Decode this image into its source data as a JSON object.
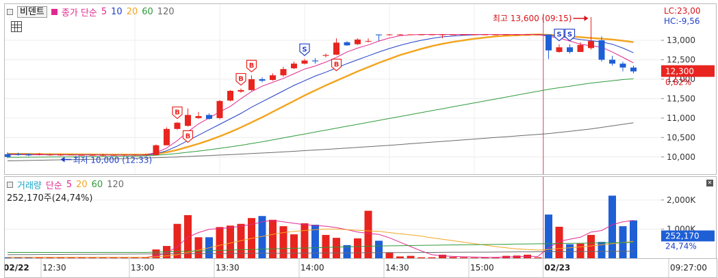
{
  "toolbar": {
    "compare_button": "비덴트"
  },
  "price_legend": {
    "label": "종가 단순",
    "periods": [
      "5",
      "10",
      "20",
      "60",
      "120"
    ],
    "colors": {
      "ma5": "#e0288f",
      "ma10": "#1f3fc8",
      "ma20": "#f2a520",
      "ma60": "#2e9a3a",
      "ma120": "#6a6a6a"
    }
  },
  "price_axis": {
    "ticks": [
      "13,000",
      "12,500",
      "12,000",
      "11,500",
      "11,000",
      "10,500",
      "10,000"
    ],
    "lc": "LC:23,00",
    "hc": "HC:-9,56",
    "current_price": "12,300",
    "current_change": "0,82%"
  },
  "annotations": {
    "high": "최고 13,600 (09:15)",
    "low": "최저 10,000 (12:33)",
    "markers": [
      "B",
      "B",
      "B",
      "S",
      "B",
      "B",
      "S",
      "S"
    ]
  },
  "volume_legend": {
    "label": "거래량",
    "ma_label": "단순",
    "periods": [
      "5",
      "20",
      "60",
      "120"
    ],
    "info": "252,170주(24,74%)"
  },
  "volume_axis": {
    "ticks": [
      "2,000K",
      "1,000K"
    ],
    "current_volume": "252,170",
    "current_pct": "24,74%"
  },
  "time_axis": {
    "labels": [
      "02/22",
      "12:30",
      "13:00",
      "13:30",
      "14:00",
      "14:30",
      "15:00",
      "02/23",
      "09:27:00"
    ]
  },
  "chart_data": [
    {
      "type": "candlestick",
      "title": "비덴트",
      "ylim": [
        9750,
        13650
      ],
      "x": [
        "02/22 12:26",
        "12:30",
        "12:34",
        "12:38",
        "12:42",
        "12:46",
        "12:50",
        "12:54",
        "12:58",
        "13:02",
        "13:06",
        "13:10",
        "13:14",
        "13:18",
        "13:22",
        "13:26",
        "13:30",
        "13:34",
        "13:38",
        "13:42",
        "13:46",
        "13:50",
        "13:54",
        "13:58",
        "14:02",
        "14:06",
        "14:10",
        "14:14",
        "14:18",
        "14:22",
        "14:26",
        "14:30",
        "14:34",
        "14:38",
        "14:42",
        "14:46",
        "14:50",
        "14:54",
        "14:58",
        "15:02",
        "15:06",
        "15:10",
        "15:14",
        "15:18",
        "15:22",
        "15:26",
        "15:30",
        "15:34",
        "15:38",
        "15:42",
        "15:46",
        "02/23 09:03",
        "09:06",
        "09:09",
        "09:12",
        "09:15",
        "09:18",
        "09:21",
        "09:24",
        "09:27"
      ],
      "open": [
        10070,
        10070,
        10060,
        10060,
        10050,
        10040,
        10040,
        10040,
        10040,
        10040,
        10040,
        10040,
        10040,
        10050,
        10050,
        10300,
        10720,
        10800,
        11000,
        11080,
        11000,
        11450,
        11680,
        11720,
        12000,
        11980,
        12100,
        12280,
        12400,
        12480,
        12600,
        12630,
        12950,
        12900,
        12980,
        13150,
        13150,
        13150,
        13150,
        13150,
        13150,
        13150,
        13150,
        13150,
        13150,
        13150,
        13150,
        13150,
        13150,
        13150,
        13150,
        13150,
        12700,
        12820,
        12700,
        12800,
        13000,
        12500,
        12400,
        12300
      ],
      "close": [
        10000,
        10050,
        10040,
        10080,
        10060,
        10060,
        10060,
        10050,
        10050,
        10050,
        10050,
        10060,
        10060,
        10060,
        10300,
        10720,
        10880,
        11080,
        11050,
        10980,
        11440,
        11700,
        11720,
        12000,
        11960,
        12100,
        12260,
        12400,
        12480,
        12460,
        12620,
        12940,
        12870,
        13020,
        12980,
        13130,
        13150,
        13150,
        13150,
        13150,
        13150,
        13150,
        13150,
        13150,
        13150,
        13150,
        13150,
        13150,
        13150,
        13150,
        13150,
        12740,
        12820,
        12700,
        12880,
        12980,
        12500,
        12400,
        12300,
        12200
      ],
      "high": [
        10120,
        10110,
        10090,
        10100,
        10080,
        10080,
        10070,
        10070,
        10070,
        10080,
        10060,
        10060,
        10060,
        10080,
        10320,
        10760,
        10900,
        11250,
        11160,
        11120,
        11460,
        11720,
        11760,
        12100,
        12050,
        12150,
        12320,
        12450,
        12520,
        12540,
        12660,
        13050,
        12980,
        13050,
        13050,
        13150,
        13160,
        13160,
        13160,
        13160,
        13160,
        13160,
        13160,
        13160,
        13160,
        13160,
        13160,
        13160,
        13160,
        13160,
        13160,
        13150,
        12900,
        12900,
        12950,
        13600,
        13100,
        12600,
        12450,
        12350
      ],
      "low": [
        9970,
        10030,
        10020,
        10040,
        10030,
        10030,
        10040,
        10030,
        10040,
        10020,
        10030,
        10030,
        10030,
        10040,
        10050,
        10300,
        10700,
        10780,
        10980,
        10960,
        10970,
        11430,
        11650,
        11700,
        11920,
        11960,
        12060,
        12260,
        12380,
        12400,
        12560,
        12620,
        12860,
        12880,
        12950,
        12980,
        13120,
        13140,
        13140,
        13140,
        13140,
        13050,
        13140,
        13140,
        13140,
        13140,
        13140,
        13140,
        13140,
        13140,
        13140,
        12520,
        12680,
        12660,
        12700,
        12760,
        12450,
        12350,
        12200,
        12150
      ],
      "ma5": [
        10060,
        10060,
        10055,
        10055,
        10055,
        10055,
        10050,
        10050,
        10050,
        10048,
        10048,
        10048,
        10048,
        10052,
        10110,
        10230,
        10420,
        10650,
        10850,
        11000,
        11160,
        11300,
        11500,
        11680,
        11820,
        11920,
        12020,
        12140,
        12260,
        12340,
        12440,
        12560,
        12700,
        12800,
        12880,
        12980,
        13060,
        13120,
        13140,
        13150,
        13150,
        13150,
        13150,
        13150,
        13150,
        13150,
        13150,
        13150,
        13150,
        13150,
        13150,
        13100,
        13060,
        12980,
        12900,
        12860,
        12820,
        12700,
        12560,
        12420
      ],
      "ma10": [
        10070,
        10068,
        10066,
        10062,
        10060,
        10058,
        10056,
        10054,
        10052,
        10050,
        10050,
        10050,
        10050,
        10050,
        10080,
        10160,
        10280,
        10420,
        10560,
        10700,
        10840,
        10980,
        11120,
        11280,
        11420,
        11560,
        11700,
        11840,
        11960,
        12080,
        12180,
        12290,
        12400,
        12500,
        12600,
        12700,
        12790,
        12870,
        12940,
        13000,
        13050,
        13090,
        13110,
        13130,
        13140,
        13150,
        13150,
        13150,
        13150,
        13150,
        13150,
        13130,
        13100,
        13060,
        13020,
        12990,
        12960,
        12900,
        12800,
        12680
      ],
      "ma20": [
        10080,
        10078,
        10076,
        10074,
        10072,
        10070,
        10068,
        10066,
        10064,
        10062,
        10060,
        10060,
        10060,
        10062,
        10080,
        10120,
        10180,
        10260,
        10340,
        10430,
        10530,
        10640,
        10760,
        10890,
        11020,
        11160,
        11300,
        11440,
        11580,
        11710,
        11840,
        11960,
        12080,
        12200,
        12310,
        12420,
        12520,
        12620,
        12700,
        12780,
        12850,
        12910,
        12960,
        13000,
        13040,
        13070,
        13100,
        13120,
        13130,
        13140,
        13150,
        13140,
        13120,
        13100,
        13080,
        13060,
        13040,
        13020,
        12990,
        12950
      ],
      "ma60": [
        9990,
        9992,
        9994,
        9996,
        9998,
        10000,
        10002,
        10004,
        10006,
        10008,
        10010,
        10015,
        10020,
        10030,
        10045,
        10065,
        10090,
        10120,
        10150,
        10185,
        10220,
        10260,
        10300,
        10345,
        10390,
        10440,
        10490,
        10540,
        10590,
        10640,
        10690,
        10740,
        10790,
        10840,
        10890,
        10940,
        10990,
        11040,
        11090,
        11140,
        11190,
        11240,
        11290,
        11340,
        11390,
        11440,
        11490,
        11540,
        11590,
        11640,
        11690,
        11740,
        11780,
        11820,
        11860,
        11900,
        11930,
        11960,
        11990,
        12010
      ],
      "ma120": [
        9900,
        9905,
        9910,
        9915,
        9920,
        9925,
        9930,
        9935,
        9940,
        9945,
        9950,
        9958,
        9966,
        9974,
        9982,
        9990,
        10000,
        10012,
        10024,
        10036,
        10048,
        10060,
        10074,
        10088,
        10102,
        10116,
        10130,
        10146,
        10162,
        10178,
        10194,
        10210,
        10228,
        10246,
        10264,
        10282,
        10300,
        10320,
        10340,
        10360,
        10380,
        10400,
        10420,
        10440,
        10460,
        10480,
        10500,
        10520,
        10540,
        10560,
        10580,
        10600,
        10630,
        10660,
        10690,
        10720,
        10760,
        10800,
        10840,
        10880
      ]
    },
    {
      "type": "bar",
      "title": "거래량",
      "ylim": [
        0,
        2700
      ],
      "series": [
        {
          "name": "거래량 (K)",
          "values": [
            30,
            30,
            30,
            30,
            30,
            30,
            30,
            30,
            30,
            30,
            30,
            30,
            30,
            30,
            300,
            420,
            1180,
            1480,
            720,
            720,
            1070,
            1120,
            1180,
            1380,
            1450,
            1320,
            1100,
            820,
            1200,
            1150,
            800,
            700,
            450,
            680,
            1630,
            600,
            200,
            60,
            80,
            30,
            30,
            120,
            40,
            30,
            20,
            20,
            20,
            80,
            90,
            120,
            30,
            1500,
            1080,
            480,
            500,
            800,
            560,
            2150,
            1100,
            1300,
            820,
            180
          ]
        },
        {
          "name": "5",
          "values": [
            30,
            30,
            30,
            30,
            30,
            30,
            30,
            30,
            30,
            30,
            30,
            30,
            30,
            30,
            80,
            180,
            400,
            720,
            880,
            990,
            1020,
            1050,
            1100,
            1160,
            1250,
            1300,
            1250,
            1200,
            1150,
            1120,
            1100,
            1050,
            980,
            900,
            850,
            820,
            700,
            550,
            400,
            250,
            120,
            80,
            60,
            50,
            40,
            30,
            30,
            40,
            50,
            60,
            60,
            360,
            580,
            650,
            720,
            900,
            950,
            1150,
            1250,
            1300,
            1260,
            1100
          ]
        },
        {
          "name": "20",
          "values": [
            30,
            30,
            30,
            30,
            30,
            30,
            30,
            30,
            30,
            30,
            30,
            30,
            30,
            30,
            50,
            80,
            120,
            200,
            280,
            360,
            440,
            520,
            600,
            680,
            750,
            820,
            880,
            920,
            950,
            980,
            1000,
            1000,
            980,
            960,
            940,
            920,
            880,
            840,
            800,
            760,
            700,
            650,
            600,
            550,
            500,
            450,
            400,
            360,
            320,
            300,
            280,
            300,
            330,
            360,
            390,
            420,
            460,
            500,
            540,
            580,
            620,
            650
          ]
        },
        {
          "name": "60",
          "values": [
            200,
            200,
            200,
            200,
            200,
            200,
            200,
            200,
            200,
            200,
            200,
            200,
            200,
            200,
            210,
            220,
            230,
            240,
            250,
            260,
            270,
            280,
            290,
            300,
            310,
            320,
            330,
            340,
            350,
            360,
            370,
            380,
            390,
            400,
            410,
            420,
            425,
            430,
            435,
            440,
            445,
            450,
            455,
            460,
            465,
            470,
            475,
            480,
            485,
            490,
            495,
            500,
            505,
            510,
            515,
            520,
            525,
            530,
            535,
            540,
            545,
            550
          ]
        },
        {
          "name": "120",
          "values": [
            120,
            122,
            124,
            126,
            128,
            130,
            132,
            134,
            136,
            138,
            140,
            142,
            144,
            146,
            148,
            150,
            152,
            154,
            156,
            158,
            160,
            162,
            164,
            166,
            168,
            170,
            172,
            174,
            176,
            178,
            180,
            182,
            184,
            186,
            188,
            190,
            192,
            194,
            196,
            198,
            200,
            202,
            204,
            206,
            208,
            210,
            212,
            214,
            216,
            218,
            220,
            222,
            224,
            226,
            228,
            230,
            232,
            234,
            236,
            238,
            240,
            242
          ]
        }
      ]
    }
  ]
}
